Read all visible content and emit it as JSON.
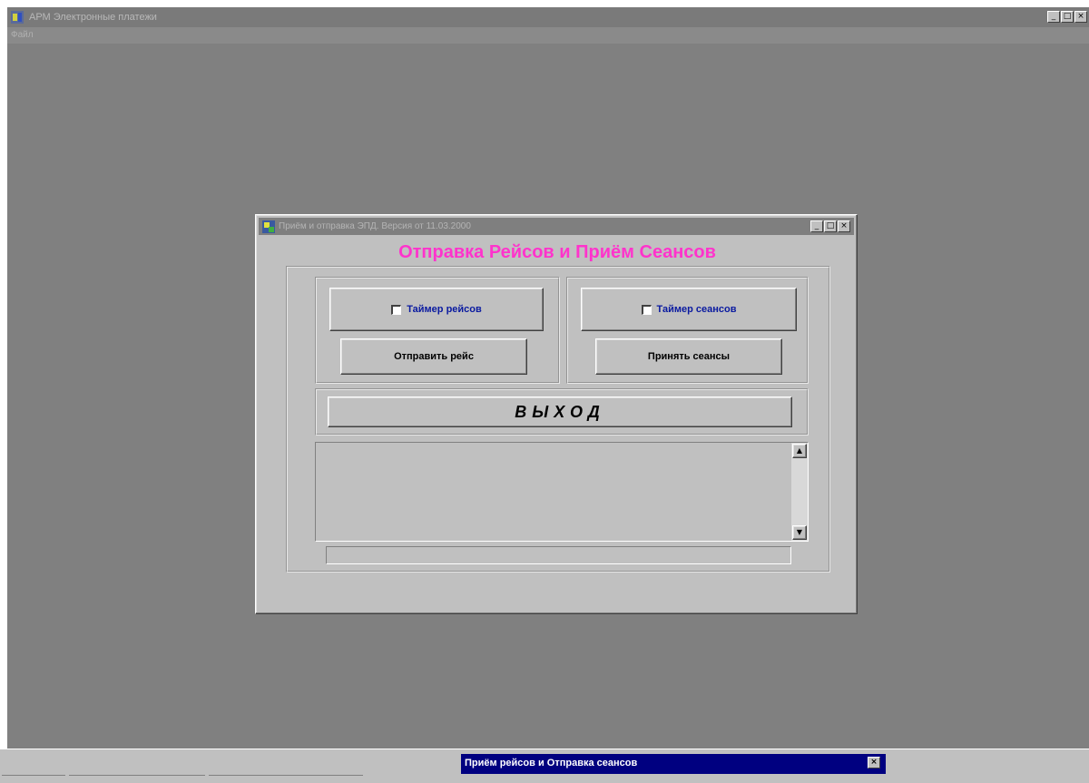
{
  "main_window": {
    "title": "АРМ Электронные платежи",
    "menu": [
      "Файл"
    ],
    "controls": {
      "minimize": "_",
      "maximize": "□",
      "close": "×"
    }
  },
  "dialog": {
    "title": "Приём и отправка ЭПД. Версия от 11.03.2000",
    "heading": "Отправка Рейсов и Приём Сеансов",
    "controls": {
      "minimize": "_",
      "maximize": "□",
      "close": "×"
    },
    "flights": {
      "timer_label": "Таймер рейсов",
      "timer_checked": false,
      "send_button": "Отправить рейс"
    },
    "sessions": {
      "timer_label": "Таймер сеансов",
      "timer_checked": false,
      "receive_button": "Принять сеансы"
    },
    "exit_button": "ВЫХОД",
    "log_text": "",
    "status_text": "",
    "scroll": {
      "up": "▲",
      "down": "▼"
    }
  },
  "taskbar": {
    "window_title": "Приём рейсов и Отправка  сеансов",
    "close": "×"
  },
  "colors": {
    "desktop": "#808080",
    "dialog_face": "#c0c0c0",
    "heading": "#ff33cc",
    "checkbox_label": "#0a1aa0",
    "active_title": "#000080"
  }
}
